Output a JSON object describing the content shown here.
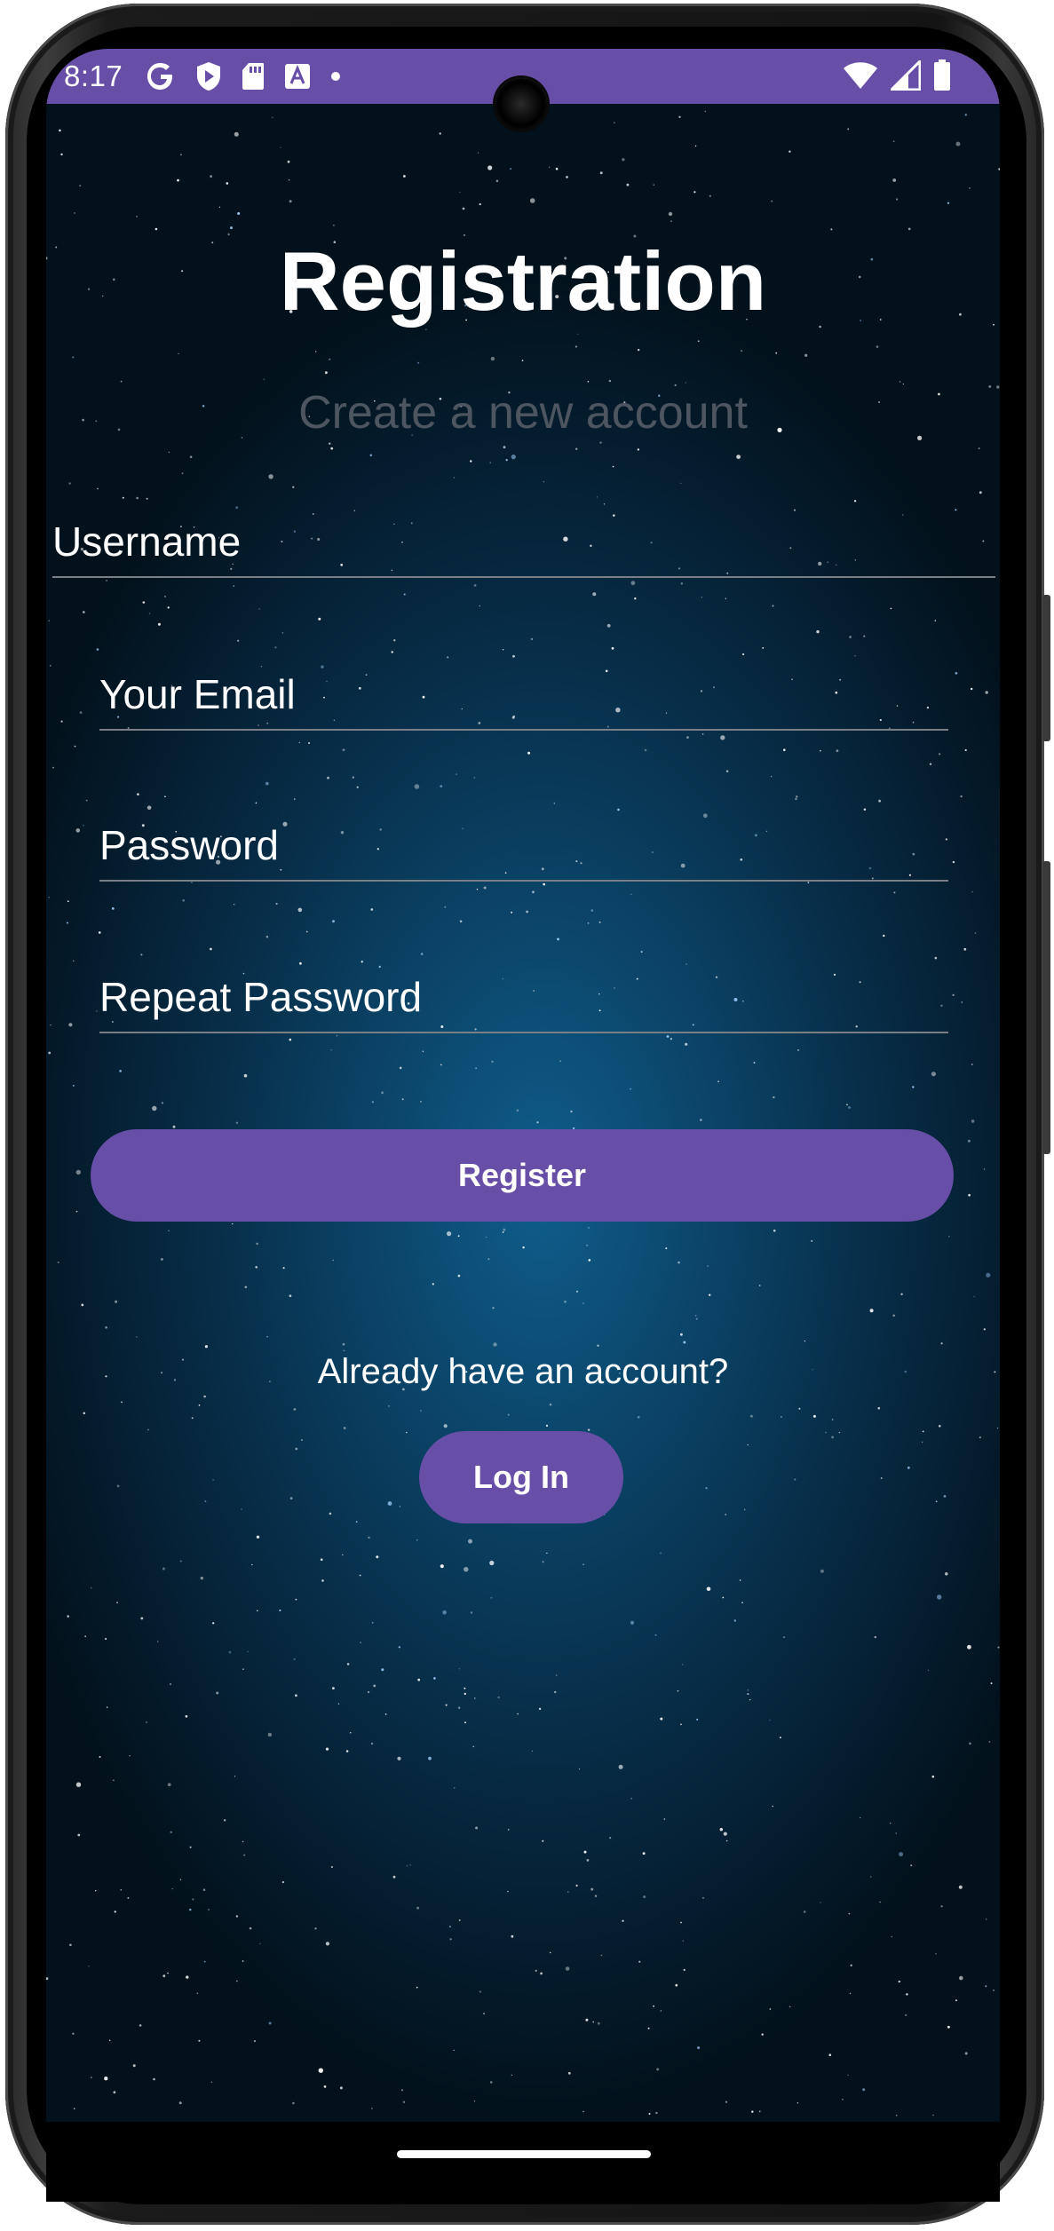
{
  "status_bar": {
    "time": "8:17",
    "left_icons": [
      "google-icon",
      "shield-play-icon",
      "sd-card-icon",
      "font-icon",
      "dot-icon"
    ],
    "right_icons": [
      "wifi-icon",
      "signal-icon",
      "battery-icon"
    ],
    "color": "#674ea7"
  },
  "header": {
    "title": "Registration",
    "subtitle": "Create a new account"
  },
  "form": {
    "username_placeholder": "Username",
    "email_placeholder": "Your Email",
    "password_placeholder": "Password",
    "repeat_password_placeholder": "Repeat Password",
    "register_label": "Register"
  },
  "footer": {
    "prompt": "Already have an account?",
    "login_label": "Log In"
  },
  "colors": {
    "accent": "#674ea7",
    "subtitle": "#4d5660",
    "background": "#0b4468"
  }
}
